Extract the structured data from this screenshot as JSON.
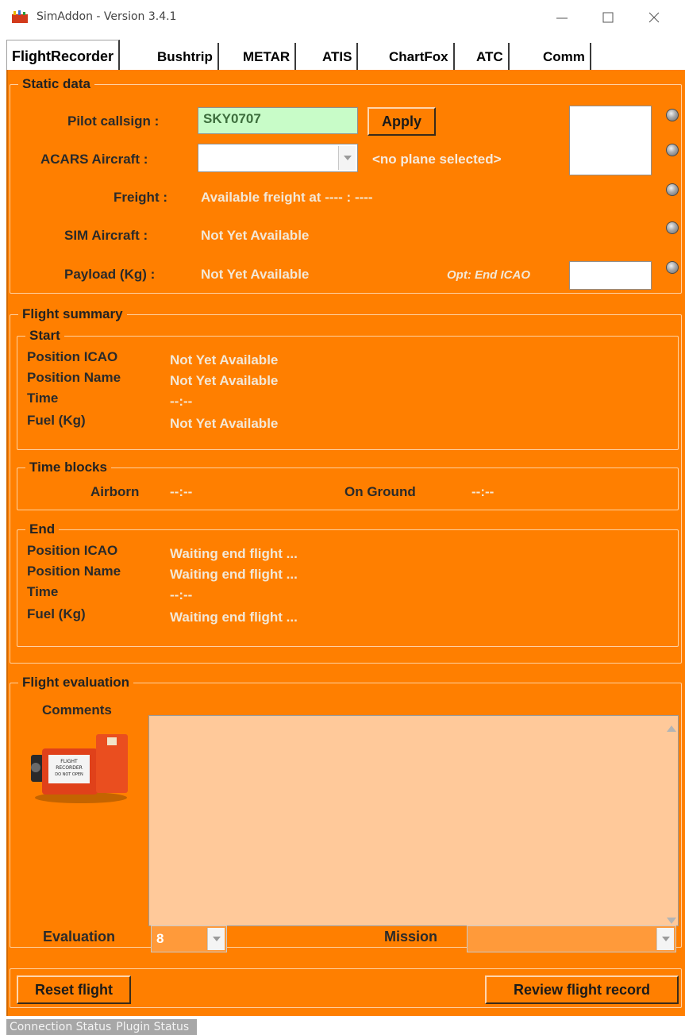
{
  "window": {
    "title": "SimAddon - Version 3.4.1"
  },
  "tabs": [
    {
      "label": "FlightRecorder",
      "active": true
    },
    {
      "label": "Bushtrip"
    },
    {
      "label": "METAR"
    },
    {
      "label": "ATIS"
    },
    {
      "label": "ChartFox"
    },
    {
      "label": "ATC"
    },
    {
      "label": "Comm"
    }
  ],
  "static_data": {
    "title": "Static data",
    "pilot_callsign_label": "Pilot callsign :",
    "pilot_callsign_value": "SKY0707",
    "apply_label": "Apply",
    "acars_label": "ACARS Aircraft :",
    "acars_value": "",
    "no_plane": "<no plane selected>",
    "freight_label": "Freight :",
    "freight_value": "Available freight at ---- : ----",
    "sim_aircraft_label": "SIM Aircraft :",
    "sim_aircraft_value": "Not Yet Available",
    "payload_label": "Payload (Kg) :",
    "payload_value": "Not Yet Available",
    "opt_end_icao_label": "Opt: End ICAO",
    "opt_end_icao_value": ""
  },
  "flight_summary": {
    "title": "Flight summary",
    "start": {
      "title": "Start",
      "position_icao_label": "Position ICAO",
      "position_icao_value": "Not Yet Available",
      "position_name_label": "Position Name",
      "position_name_value": "Not Yet Available",
      "time_label": "Time",
      "time_value": "--:--",
      "fuel_label": "Fuel (Kg)",
      "fuel_value": "Not Yet Available"
    },
    "time_blocks": {
      "title": "Time blocks",
      "airborn_label": "Airborn",
      "airborn_value": "--:--",
      "on_ground_label": "On Ground",
      "on_ground_value": "--:--"
    },
    "end": {
      "title": "End",
      "position_icao_label": "Position ICAO",
      "position_icao_value": "Waiting end flight ...",
      "position_name_label": "Position Name",
      "position_name_value": "Waiting end flight ...",
      "time_label": "Time",
      "time_value": "--:--",
      "fuel_label": "Fuel (Kg)",
      "fuel_value": "Waiting end flight ..."
    }
  },
  "flight_evaluation": {
    "title": "Flight evaluation",
    "comments_label": "Comments",
    "comments_value": "",
    "evaluation_label": "Evaluation",
    "evaluation_value": "8",
    "mission_label": "Mission",
    "mission_value": "",
    "recorder_image_text": "FLIGHT RECORDER DO NOT OPEN"
  },
  "actions": {
    "reset_label": "Reset flight",
    "review_label": "Review flight record"
  },
  "statusbar": {
    "connection": "Connection Status",
    "plugin": "Plugin Status"
  },
  "colors": {
    "panel": "#ff7f00",
    "callsign_bg": "#c8fcc8",
    "comments_bg": "#ffc99a"
  }
}
